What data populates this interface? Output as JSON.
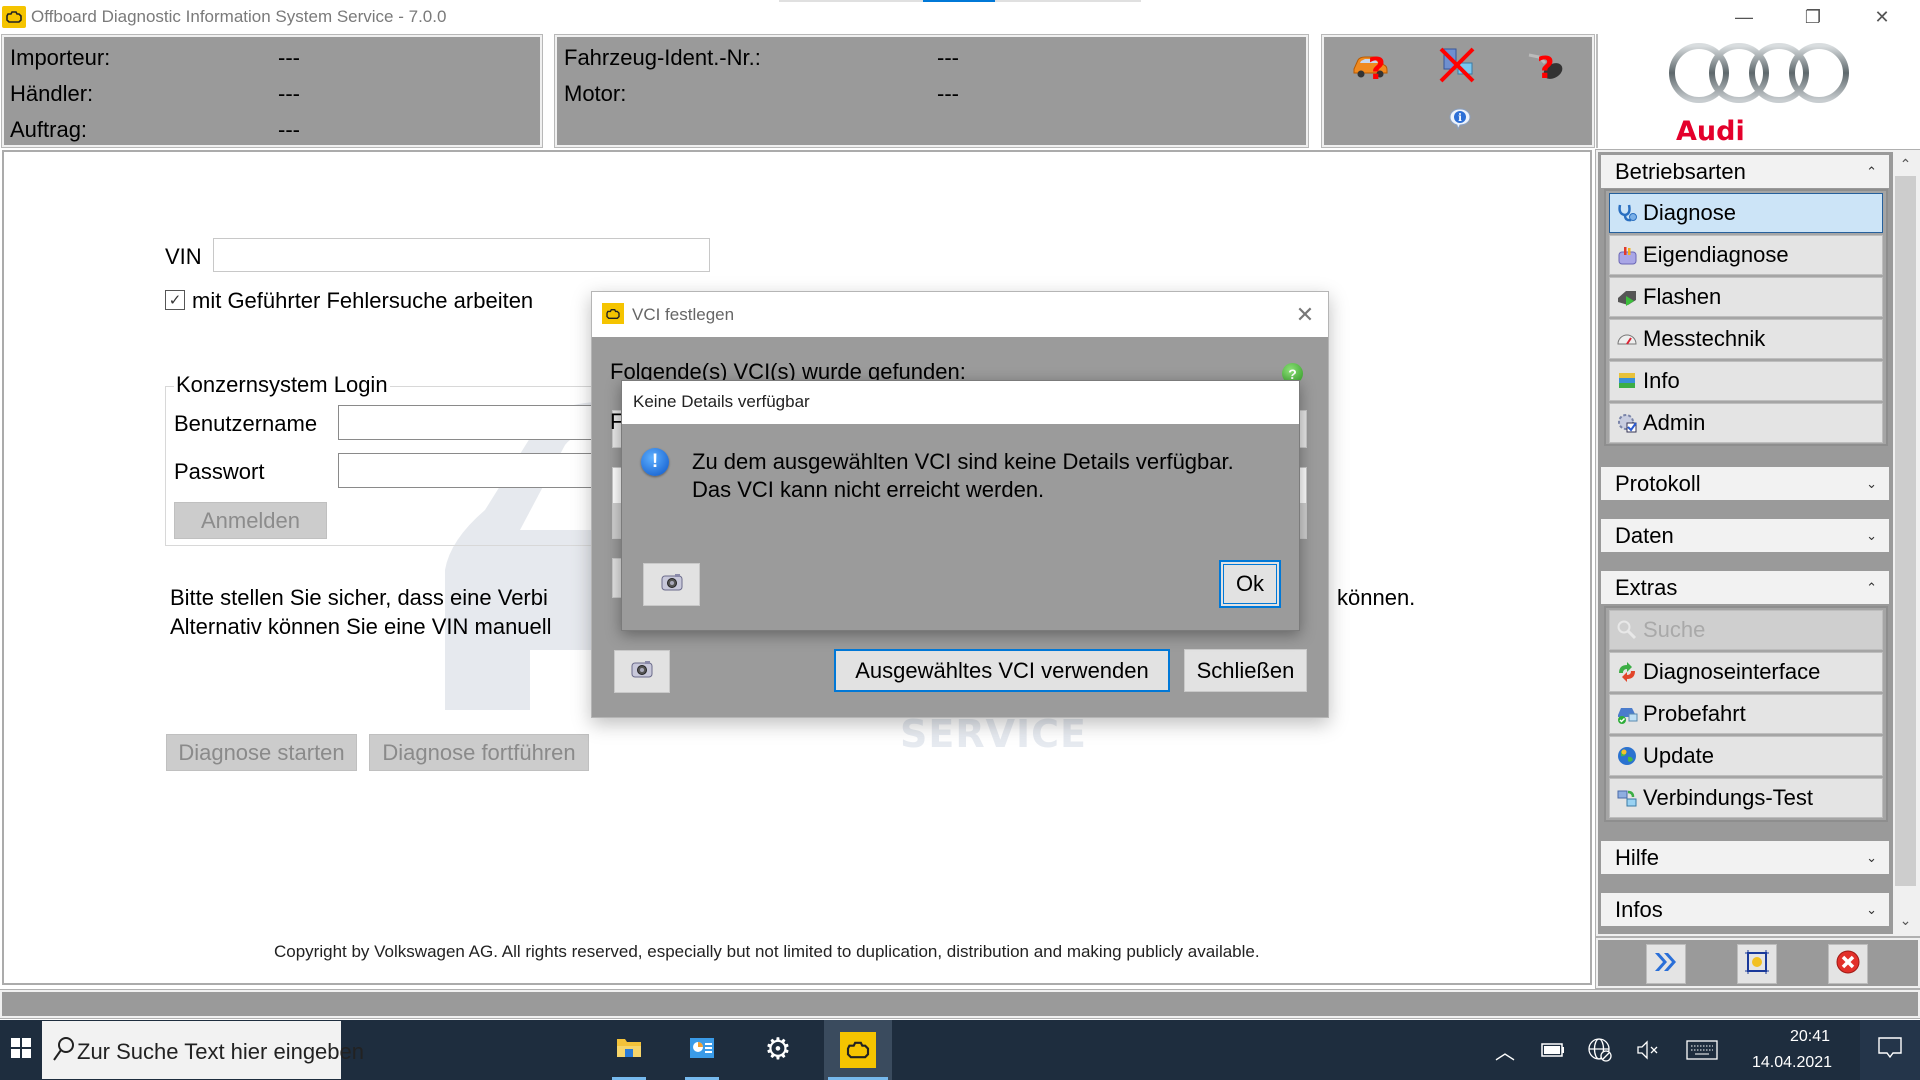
{
  "window": {
    "title": "Offboard Diagnostic Information System Service - 7.0.0",
    "controls": {
      "minimize": "—",
      "restore": "❐",
      "close": "✕"
    }
  },
  "header": {
    "left": [
      {
        "label": "Importeur:",
        "value": "---"
      },
      {
        "label": "Händler:",
        "value": "---"
      },
      {
        "label": "Auftrag:",
        "value": "---"
      }
    ],
    "middle": [
      {
        "label": "Fahrzeug-Ident.-Nr.:",
        "value": "---"
      },
      {
        "label": "Motor:",
        "value": "---"
      }
    ],
    "status_icons": [
      "vehicle-unknown-icon",
      "server-disconnected-icon",
      "vci-unknown-icon",
      "info-icon"
    ],
    "brand": "Audi"
  },
  "main": {
    "vin_label": "VIN",
    "vin_value": "",
    "guided_checkbox_label": "mit Geführter Fehlersuche arbeiten",
    "guided_checked": true,
    "login": {
      "legend": "Konzernsystem Login",
      "username_label": "Benutzername",
      "username_value": "",
      "password_label": "Passwort",
      "password_value": "",
      "login_button": "Anmelden"
    },
    "info_line1": "Bitte stellen Sie sicher, dass eine Verbi",
    "info_line1_end": "können.",
    "info_line2": "Alternativ können Sie eine VIN manuell",
    "diagnose_start": "Diagnose starten",
    "diagnose_continue": "Diagnose fortführen",
    "watermark": "SERVICE",
    "copyright": "Copyright by Volkswagen AG. All rights reserved, especially but not limited to duplication, distribution and making publicly available."
  },
  "sidebar": {
    "sections": [
      {
        "title": "Betriebsarten",
        "expanded": true,
        "items": [
          {
            "label": "Diagnose",
            "icon": "stethoscope-icon",
            "active": true
          },
          {
            "label": "Eigendiagnose",
            "icon": "toolbox-icon"
          },
          {
            "label": "Flashen",
            "icon": "flash-play-icon"
          },
          {
            "label": "Messtechnik",
            "icon": "gauge-icon"
          },
          {
            "label": "Info",
            "icon": "books-icon"
          },
          {
            "label": "Admin",
            "icon": "gear-check-icon"
          }
        ]
      },
      {
        "title": "Protokoll",
        "expanded": false
      },
      {
        "title": "Daten",
        "expanded": false
      },
      {
        "title": "Extras",
        "expanded": true,
        "items": [
          {
            "label": "Suche",
            "icon": "magnifier-icon",
            "disabled": true
          },
          {
            "label": "Diagnoseinterface",
            "icon": "refresh-arrows-icon"
          },
          {
            "label": "Probefahrt",
            "icon": "car-check-icon"
          },
          {
            "label": "Update",
            "icon": "globe-icon"
          },
          {
            "label": "Verbindungs-Test",
            "icon": "network-test-icon"
          }
        ]
      },
      {
        "title": "Hilfe",
        "expanded": false
      },
      {
        "title": "Infos",
        "expanded": false
      }
    ],
    "chevron_up": "⌃",
    "chevron_down": "⌄",
    "bottom_buttons": [
      "forward-icon",
      "fit-window-icon",
      "exit-icon"
    ]
  },
  "vci_dialog": {
    "title": "VCI festlegen",
    "found_label": "Folgende(s) VCI(s) wurde gefunden:",
    "sub_label_visible": "F",
    "use_button": "Ausgewähltes VCI verwenden",
    "close_button": "Schließen"
  },
  "message_box": {
    "title": "Keine Details verfügbar",
    "line1": "Zu dem ausgewählten VCI sind keine Details verfügbar.",
    "line2": "Das VCI kann nicht erreicht werden.",
    "ok_button": "Ok"
  },
  "taskbar": {
    "search_placeholder": "Zur Suche Text hier eingeben",
    "apps": [
      "file-explorer-icon",
      "control-panel-icon",
      "settings-icon",
      "odis-icon"
    ],
    "time": "20:41",
    "date": "14.04.2021"
  }
}
